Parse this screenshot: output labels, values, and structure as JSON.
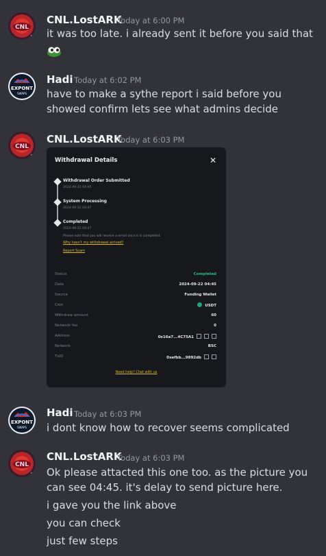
{
  "messages": [
    {
      "author": "CNL.LostARK",
      "time": "Today at 6:00 PM",
      "lines": [
        "it was too late. i already sent it before you said that"
      ]
    },
    {
      "author": "Hadi",
      "time": "Today at 6:02 PM",
      "lines": [
        "have to make a sythe report i said before you",
        "showed confirm lets see what admins decide"
      ]
    },
    {
      "author": "CNL.LostARK",
      "time": "Today at 6:03 PM",
      "lines": []
    },
    {
      "author": "Hadi",
      "time": "Today at 6:03 PM",
      "lines": [
        "i dont know how to recover seems complicated"
      ]
    },
    {
      "author": "CNL.LostARK",
      "time": "Today at 6:03 PM",
      "lines": [
        "Ok please attacted this one too. as the picture you",
        "can see 04:45. it's delay to send picture here.",
        "i gave you the link above",
        "you can check",
        "just few steps"
      ]
    }
  ],
  "avatars": {
    "cnl_text": "CNL",
    "hadi_text_1": "EXPONT",
    "hadi_text_2": "SWAPS"
  },
  "withdrawal": {
    "title": "Withdrawal Details",
    "close": "✕",
    "steps": [
      {
        "title": "Withdrawal Order Submitted",
        "date": "2024-09-22 04:45"
      },
      {
        "title": "System Processing",
        "date": "2024-09-22 04:47"
      },
      {
        "title": "Completed",
        "date": "2024-09-22 04:47"
      }
    ],
    "note": "Please note that you will receive a email once it is completed.",
    "link_arrived": "Why hasn't my withdrawal arrived?",
    "link_report": "Report Scam",
    "details": [
      {
        "key": "Status",
        "value": "Completed"
      },
      {
        "key": "Date",
        "value": "2024-09-22 04:45"
      },
      {
        "key": "Source",
        "value": "Funding Wallet"
      },
      {
        "key": "Coin",
        "value": "USDT"
      },
      {
        "key": "Withdraw amount",
        "value": "60"
      },
      {
        "key": "Network fee",
        "value": "0"
      },
      {
        "key": "Address",
        "value": "0x16a7...4C75A1"
      },
      {
        "key": "Network",
        "value": "BSC"
      },
      {
        "key": "TxID",
        "value": "0xefbb...9892db"
      }
    ],
    "help": "Need help? Chat with us"
  },
  "colors": {
    "background": "#313338",
    "author": "#f2f3f5",
    "timestamp": "#949ba4",
    "text": "#dbdee1",
    "completed": "#2ebd85",
    "link": "#e0b623"
  },
  "icons": {
    "emoji": "frog-eyes-emoji",
    "usdt": "usdt-coin-icon",
    "copy": "copy-icon",
    "qr": "qr-icon",
    "link": "link-icon"
  }
}
